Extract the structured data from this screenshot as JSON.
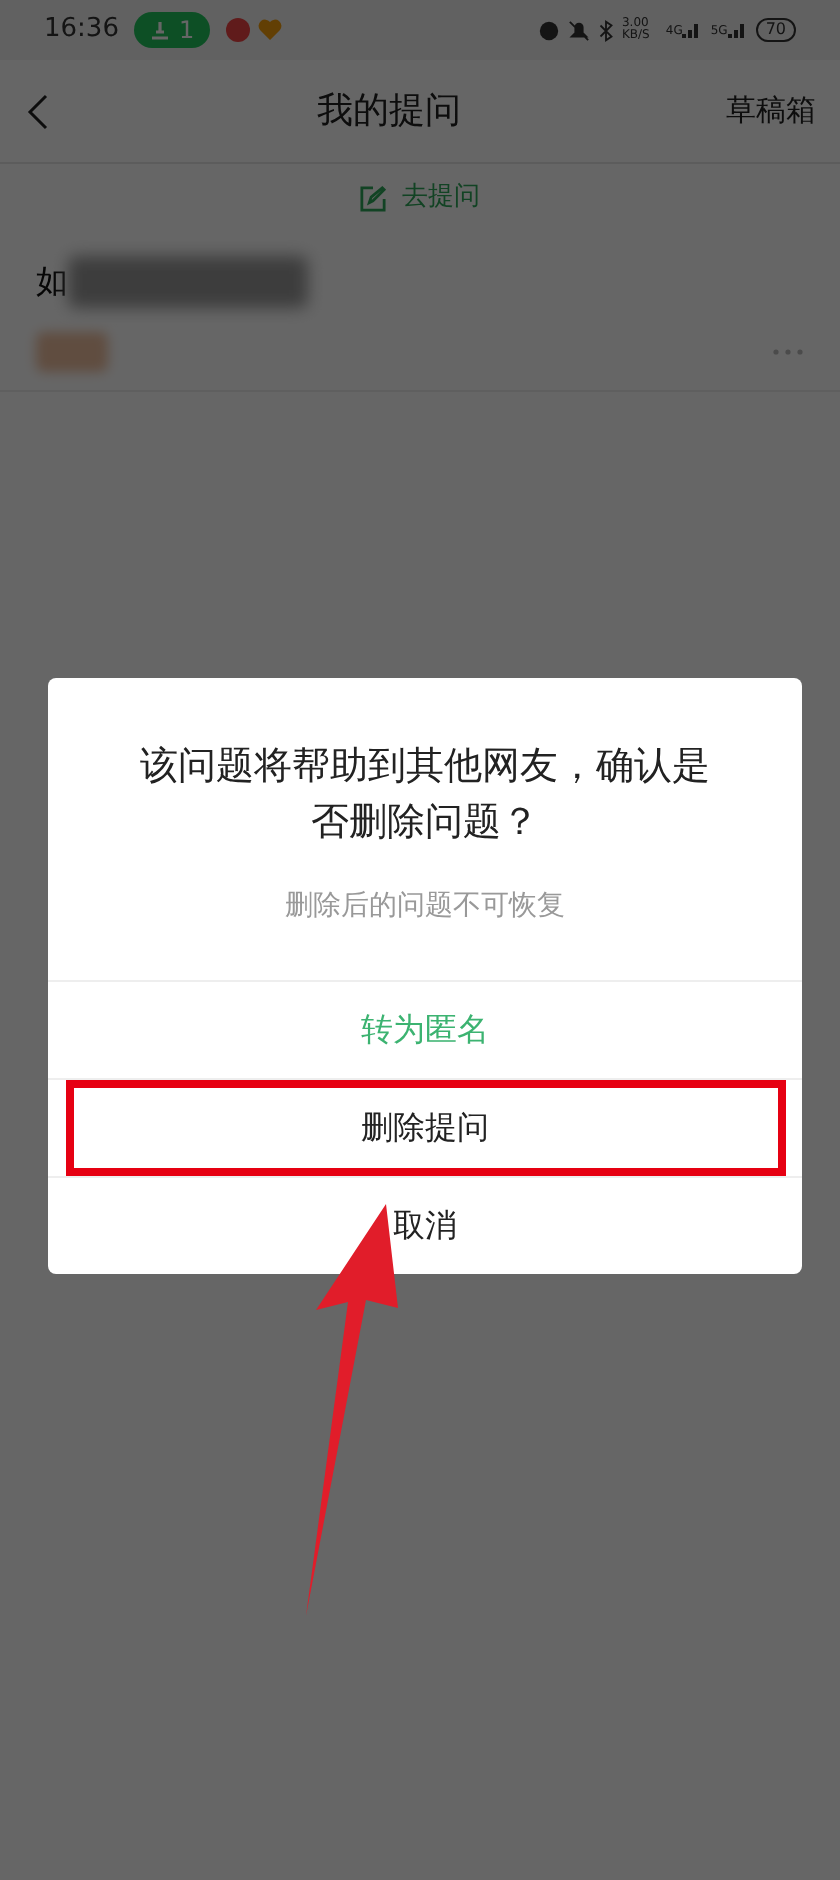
{
  "status_bar": {
    "time": "16:36",
    "badge": "1",
    "network_speed": "3.00",
    "speed_unit": "KB/S",
    "signal_1": "4G",
    "signal_2": "5G",
    "battery": "70"
  },
  "header": {
    "title": "我的提问",
    "action": "草稿箱"
  },
  "ask_link": "去提问",
  "questions": [
    {
      "title_start": "如"
    }
  ],
  "dialog": {
    "title": "该问题将帮助到其他网友，确认是否删除问题？",
    "subtitle": "删除后的问题不可恢复",
    "actions": [
      {
        "label": "转为匿名",
        "kind": "accent",
        "highlighted": false
      },
      {
        "label": "删除提问",
        "kind": "normal",
        "highlighted": true
      },
      {
        "label": "取消",
        "kind": "normal",
        "highlighted": false
      }
    ]
  }
}
